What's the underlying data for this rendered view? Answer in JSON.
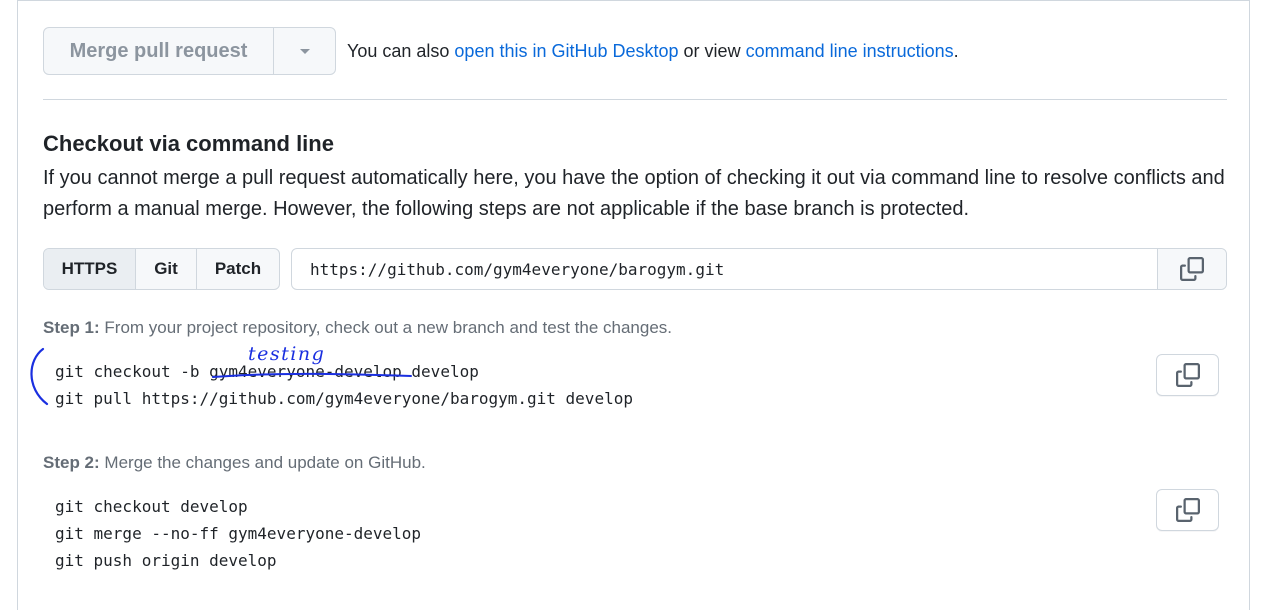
{
  "merge": {
    "button_label": "Merge pull request",
    "also_prefix": "You can also ",
    "desktop_link": "open this in GitHub Desktop",
    "also_middle": " or view ",
    "cli_link": "command line instructions",
    "also_suffix": "."
  },
  "checkout": {
    "title": "Checkout via command line",
    "description": "If you cannot merge a pull request automatically here, you have the option of checking it out via command line to resolve conflicts and perform a manual merge. However, the following steps are not applicable if the base branch is protected."
  },
  "protocols": {
    "tabs": [
      {
        "label": "HTTPS",
        "active": true
      },
      {
        "label": "Git",
        "active": false
      },
      {
        "label": "Patch",
        "active": false
      }
    ],
    "url": "https://github.com/gym4everyone/barogym.git"
  },
  "step1": {
    "label": "Step 1:",
    "text": " From your project repository, check out a new branch and test the changes.",
    "line1_prefix": "git checkout -b ",
    "line1_struck": "gym4everyone-develop",
    "line1_suffix": " develop",
    "line2": "git pull https://github.com/gym4everyone/barogym.git develop",
    "handwritten": "testing"
  },
  "step2": {
    "label": "Step 2:",
    "text": " Merge the changes and update on GitHub.",
    "line1": "git checkout develop",
    "line2": "git merge --no-ff gym4everyone-develop",
    "line3": "git push origin develop"
  },
  "icons": {
    "copy": "copy-icon",
    "caret": "triangle-down-icon"
  },
  "colors": {
    "link": "#0969da",
    "annotation": "#1a2fe0",
    "muted": "#656d76"
  }
}
